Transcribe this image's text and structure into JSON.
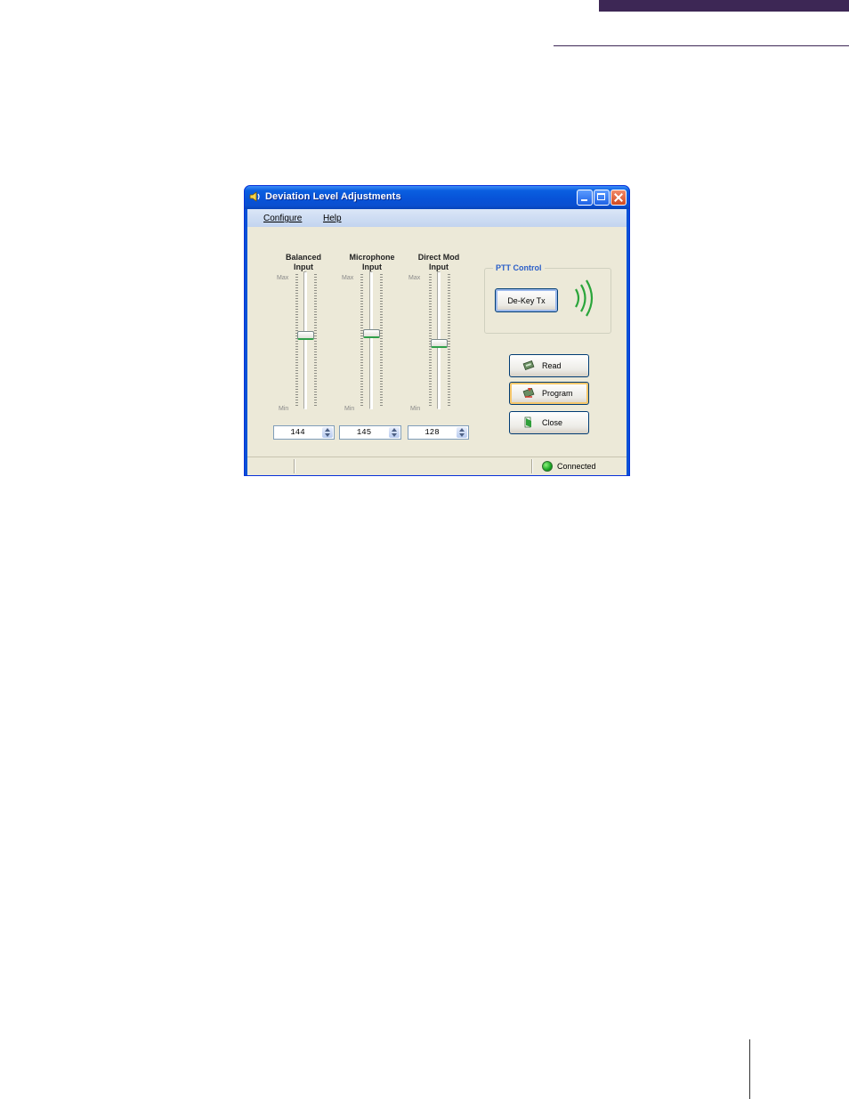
{
  "window": {
    "title": "Deviation Level Adjustments",
    "controls": {
      "minimize": "minimize-icon",
      "maximize": "maximize-icon",
      "close": "close-icon"
    }
  },
  "menu": {
    "items": [
      {
        "label": "Configure"
      },
      {
        "label": "Help"
      }
    ]
  },
  "sliders": {
    "max_label": "Max",
    "min_label": "Min",
    "items": [
      {
        "title": "Balanced\nInput",
        "value": "144",
        "level": 0.56
      },
      {
        "title": "Microphone\nInput",
        "value": "145",
        "level": 0.57
      },
      {
        "title": "Direct Mod\nInput",
        "value": "128",
        "level": 0.5
      }
    ]
  },
  "ptt": {
    "group_title": "PTT Control",
    "button_label": "De-Key Tx",
    "signal_icon": "signal-waves-icon",
    "signal_color": "#2aa53a"
  },
  "actions": {
    "read": "Read",
    "program": "Program",
    "close": "Close"
  },
  "status": {
    "connection": "Connected",
    "indicator_color": "#1aa623"
  }
}
